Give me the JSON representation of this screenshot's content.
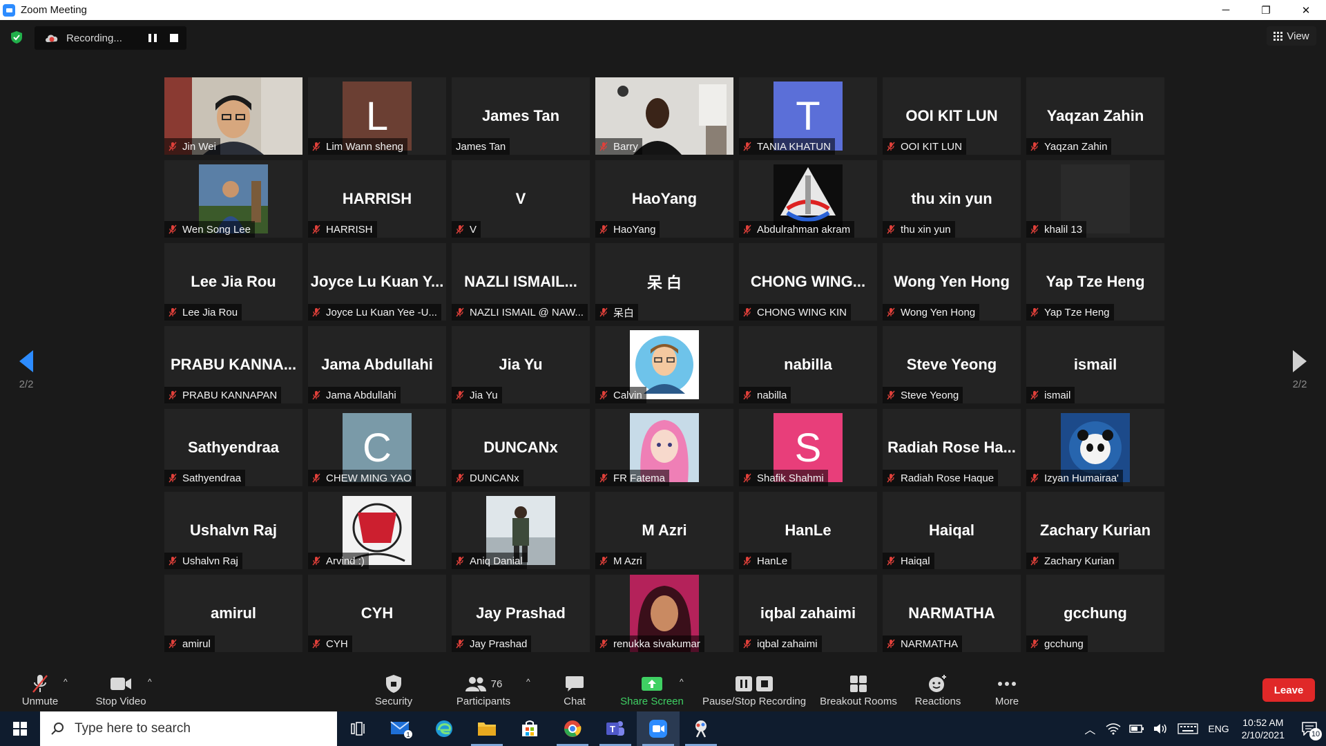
{
  "window": {
    "title": "Zoom Meeting",
    "minimize": "─",
    "restore": "❐",
    "close": "✕"
  },
  "recording": {
    "label": "Recording..."
  },
  "view": {
    "label": "View"
  },
  "pager": {
    "left_page": "2/2",
    "right_page": "2/2"
  },
  "tiles": [
    {
      "caption": "Jin Wei",
      "kind": "photo",
      "scene": "person-bright"
    },
    {
      "caption": "Lim Wann sheng",
      "kind": "letter",
      "letter": "L",
      "color": "#6b3f33"
    },
    {
      "caption": "James Tan",
      "kind": "name",
      "display": "James Tan",
      "muted": false
    },
    {
      "caption": "Barry",
      "kind": "photo",
      "scene": "person-room"
    },
    {
      "caption": "TANIA KHATUN",
      "kind": "letter",
      "letter": "T",
      "color": "#5b6fd8"
    },
    {
      "caption": "OOI KIT LUN",
      "kind": "name",
      "display": "OOI KIT LUN"
    },
    {
      "caption": "Yaqzan Zahin",
      "kind": "name",
      "display": "Yaqzan Zahin"
    },
    {
      "caption": "Wen Song Lee",
      "kind": "avatar",
      "scene": "outdoor"
    },
    {
      "caption": "HARRISH",
      "kind": "name",
      "display": "HARRISH"
    },
    {
      "caption": "V",
      "kind": "name",
      "display": "V"
    },
    {
      "caption": "HaoYang",
      "kind": "name",
      "display": "HaoYang"
    },
    {
      "caption": "Abdulrahman akram",
      "kind": "avatar",
      "scene": "rocket"
    },
    {
      "caption": "thu xin yun",
      "kind": "name",
      "display": "thu xin yun"
    },
    {
      "caption": "khalil 13",
      "kind": "avatar",
      "scene": "dark"
    },
    {
      "caption": "Lee Jia Rou",
      "kind": "name",
      "display": "Lee Jia Rou"
    },
    {
      "caption": "Joyce Lu Kuan Yee -U...",
      "kind": "name",
      "display": "Joyce Lu Kuan Y..."
    },
    {
      "caption": "NAZLI ISMAIL @ NAW...",
      "kind": "name",
      "display": "NAZLI  ISMAIL..."
    },
    {
      "caption": "呆白",
      "kind": "name",
      "display": "呆 白"
    },
    {
      "caption": "CHONG WING KIN",
      "kind": "name",
      "display": "CHONG  WING..."
    },
    {
      "caption": "Wong Yen Hong",
      "kind": "name",
      "display": "Wong Yen Hong"
    },
    {
      "caption": "Yap Tze Heng",
      "kind": "name",
      "display": "Yap Tze Heng"
    },
    {
      "caption": "PRABU KANNAPAN",
      "kind": "name",
      "display": "PRABU  KANNA..."
    },
    {
      "caption": "Jama Abdullahi",
      "kind": "name",
      "display": "Jama Abdullahi"
    },
    {
      "caption": "Jia Yu",
      "kind": "name",
      "display": "Jia Yu"
    },
    {
      "caption": "Calvin",
      "kind": "avatar",
      "scene": "cartoon"
    },
    {
      "caption": "nabilla",
      "kind": "name",
      "display": "nabilla"
    },
    {
      "caption": "Steve Yeong",
      "kind": "name",
      "display": "Steve Yeong"
    },
    {
      "caption": "ismail",
      "kind": "name",
      "display": "ismail"
    },
    {
      "caption": "Sathyendraa",
      "kind": "name",
      "display": "Sathyendraa"
    },
    {
      "caption": "CHEW MING YAO",
      "kind": "letter",
      "letter": "C",
      "color": "#7a9aa8"
    },
    {
      "caption": "DUNCANx",
      "kind": "name",
      "display": "DUNCANx"
    },
    {
      "caption": "FR Fatema",
      "kind": "avatar",
      "scene": "anime"
    },
    {
      "caption": "Shafik Shahmi",
      "kind": "letter",
      "letter": "S",
      "color": "#e83e7a"
    },
    {
      "caption": "Radiah Rose Haque",
      "kind": "name",
      "display": "Radiah  Rose  Ha..."
    },
    {
      "caption": "Izyan Humairaa'",
      "kind": "avatar",
      "scene": "panda"
    },
    {
      "caption": "Ushalvn Raj",
      "kind": "name",
      "display": "Ushalvn Raj"
    },
    {
      "caption": "Arvind :)",
      "kind": "avatar",
      "scene": "sketch"
    },
    {
      "caption": "Aniq Danial",
      "kind": "avatar",
      "scene": "beach"
    },
    {
      "caption": "M Azri",
      "kind": "name",
      "display": "M Azri"
    },
    {
      "caption": "HanLe",
      "kind": "name",
      "display": "HanLe"
    },
    {
      "caption": "Haiqal",
      "kind": "name",
      "display": "Haiqal"
    },
    {
      "caption": "Zachary Kurian",
      "kind": "name",
      "display": "Zachary Kurian"
    },
    {
      "caption": "amirul",
      "kind": "name",
      "display": "amirul"
    },
    {
      "caption": "CYH",
      "kind": "name",
      "display": "CYH"
    },
    {
      "caption": "Jay Prashad",
      "kind": "name",
      "display": "Jay Prashad"
    },
    {
      "caption": "renukka sivakumar",
      "kind": "avatar",
      "scene": "portrait"
    },
    {
      "caption": "iqbal zahaimi",
      "kind": "name",
      "display": "iqbal zahaimi"
    },
    {
      "caption": "NARMATHA",
      "kind": "name",
      "display": "NARMATHA"
    },
    {
      "caption": "gcchung",
      "kind": "name",
      "display": "gcchung"
    }
  ],
  "toolbar": {
    "unmute": "Unmute",
    "stop_video": "Stop Video",
    "security": "Security",
    "participants": "Participants",
    "participants_count": "76",
    "chat": "Chat",
    "share_screen": "Share Screen",
    "pause_stop_recording": "Pause/Stop Recording",
    "breakout_rooms": "Breakout Rooms",
    "reactions": "Reactions",
    "more": "More",
    "leave": "Leave",
    "caret": "^"
  },
  "taskbar": {
    "search_placeholder": "Type here to search",
    "mail_badge": "1",
    "lang": "ENG",
    "time": "10:52 AM",
    "date": "2/10/2021",
    "notif_count": "10"
  },
  "colors": {
    "background": "#1a1a1a",
    "tile": "#232323",
    "share_green": "#3fd063",
    "leave_red": "#e02828",
    "mute_red": "#e0403a",
    "arrow_blue": "#2d8cff"
  }
}
